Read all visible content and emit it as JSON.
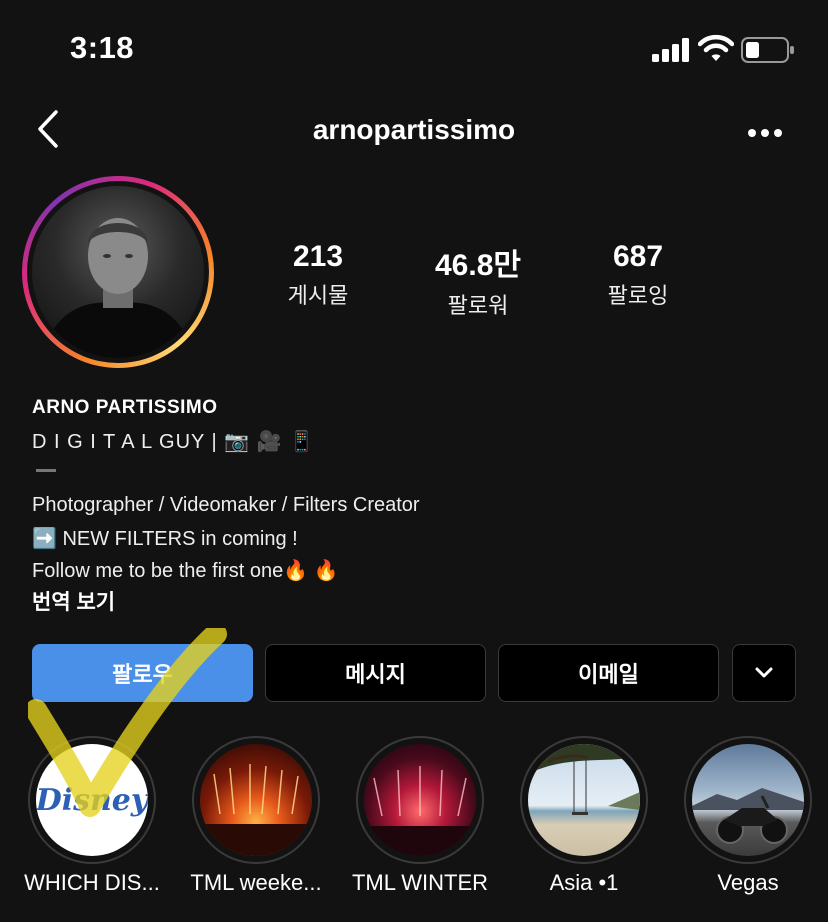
{
  "status_bar": {
    "time": "3:18"
  },
  "header": {
    "username": "arnopartissimo"
  },
  "stats": [
    {
      "value": "213",
      "label": "게시물"
    },
    {
      "value": "46.8만",
      "label": "팔로워"
    },
    {
      "value": "687",
      "label": "팔로잉"
    }
  ],
  "profile": {
    "name": "ARNO PARTISSIMO",
    "tagline": "D I G I T A L GUY | 📷 🎥 📱",
    "bio": [
      "Photographer / Videomaker / Filters Creator",
      "➡️ NEW FILTERS in coming !",
      "Follow me to be the first one🔥 🔥"
    ],
    "translate": "번역 보기"
  },
  "buttons": {
    "follow": "팔로우",
    "message": "메시지",
    "email": "이메일"
  },
  "highlights": [
    {
      "label": "WHICH DIS...",
      "logo_text": "Disney"
    },
    {
      "label": "TML weeke..."
    },
    {
      "label": "TML WINTER"
    },
    {
      "label": "Asia •1"
    },
    {
      "label": "Vegas"
    }
  ],
  "colors": {
    "follow_button": "#4a8fe8",
    "background": "#121212",
    "annotation": "#e6d21e"
  }
}
